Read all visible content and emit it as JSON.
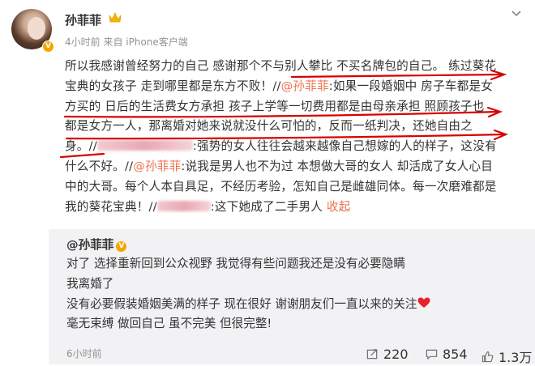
{
  "post": {
    "author_name": "孙菲菲",
    "meta": "4小时前  来自 iPhone客户端",
    "lines": [
      {
        "pre": "所以我感谢曾经努力的自己 感谢那个不与别人攀比 不买名牌包的自己。 练过葵花",
        "mention": "",
        "post": ""
      },
      {
        "pre": "宝典的女孩子 走到哪里都是东方不败！//",
        "mention": "@孙菲菲",
        "post": ":如果一段婚姻中 房子车都是女"
      },
      {
        "pre": "方买的 日后的生活费女方承担  孩子上学等一切费用都是由母亲承担  照顾孩子也",
        "mention": "",
        "post": ""
      },
      {
        "pre": "都是女方一人，那离婚对她来说就没什么可怕的，反而一纸判决，还她自由之",
        "mention": "",
        "post": ""
      },
      {
        "pre": "身。//",
        "mention": "",
        "post": ":强势的女人往往会越来越像自己想嫁的人的样子，这没有"
      },
      {
        "pre": "什么不好。//",
        "mention": "@孙菲菲",
        "post": ":说我是男人也不为过 本想做大哥的女人 却活成了女人心目"
      },
      {
        "pre": "中的大哥。每个人本自具足，不经历考验，怎知自己是雌雄同体。每一次磨难都是",
        "mention": "",
        "post": ""
      },
      {
        "pre": "我的葵花宝典！//",
        "mention": "",
        "post": ":这下她成了二手男人",
        "collapse": "收起"
      }
    ]
  },
  "repost": {
    "author": "@孙菲菲",
    "lines": [
      "对了 选择重新回到公众视野 我觉得有些问题我还是没有必要隐瞒",
      "我离婚了",
      "没有必要假装婚姻美满的样子 现在很好 谢谢朋友们一直以来的关注",
      "毫无束缚 做回自己 虽不完美 但很完整!"
    ],
    "time": "6小时前"
  },
  "actions": {
    "reposts": "220",
    "comments": "854",
    "likes": "1.3万"
  },
  "colors": {
    "accent": "#eb7350",
    "annotation_red": "#d80000",
    "repost_bg": "#f2f2f5",
    "meta_gray": "#939393"
  }
}
